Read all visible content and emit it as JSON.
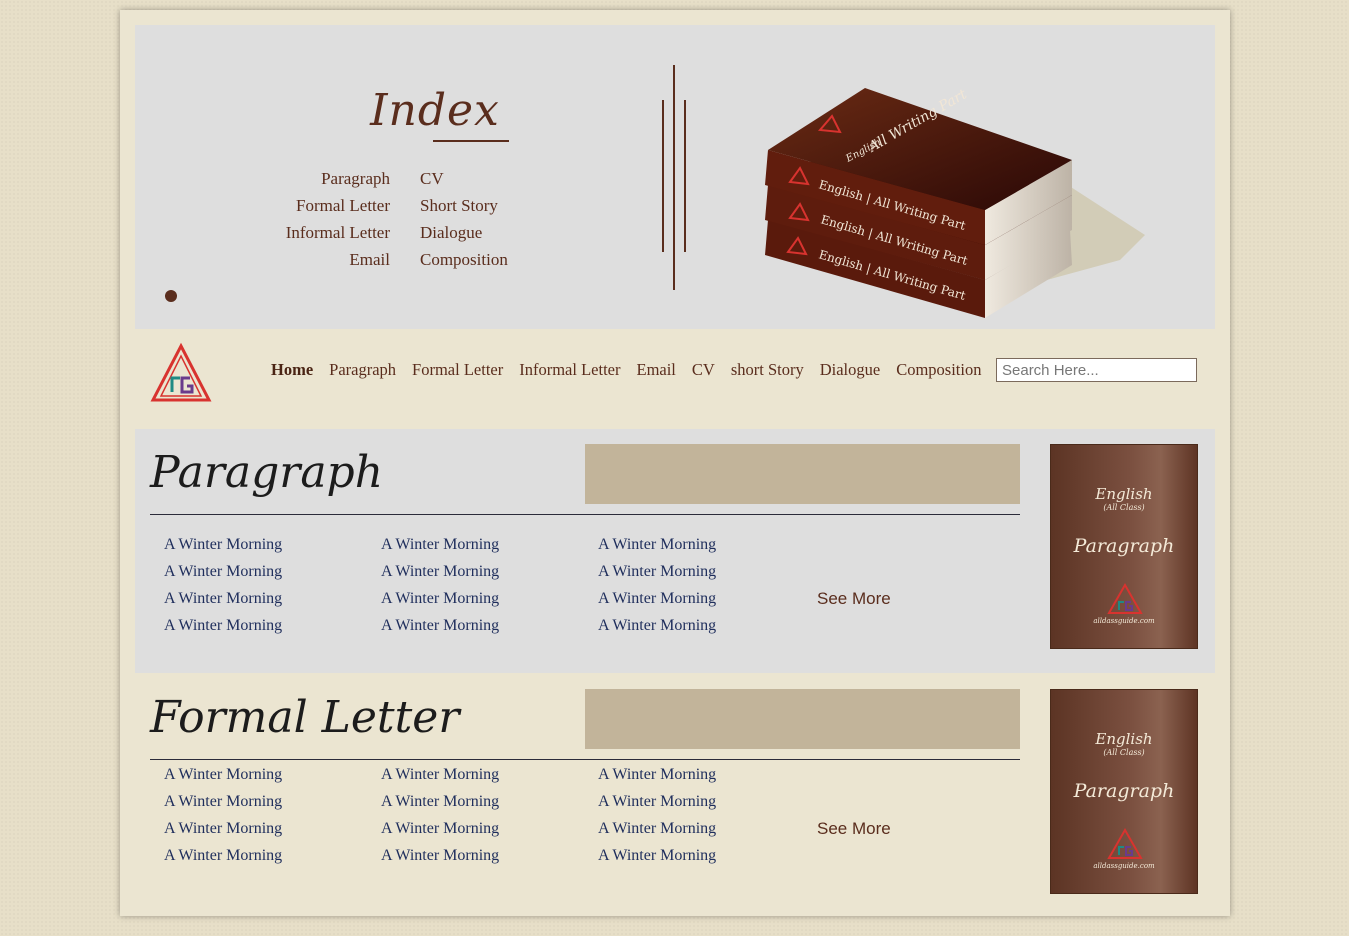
{
  "banner": {
    "index_title": "Index",
    "index_left": [
      "Paragraph",
      "Formal Letter",
      "Informal Letter",
      "Email"
    ],
    "index_right": [
      "CV",
      "Short Story",
      "Dialogue",
      "Composition"
    ],
    "book_spine_title": "English | All Writing Part",
    "book_top_brand": "English",
    "book_top_title": "All Writing Part"
  },
  "nav": {
    "items": [
      "Home",
      "Paragraph",
      "Formal Letter",
      "Informal Letter",
      "Email",
      "CV",
      "short Story",
      "Dialogue",
      "Composition"
    ],
    "search_placeholder": "Search Here..."
  },
  "sections": [
    {
      "title": "Paragraph",
      "links": [
        [
          "A Winter Morning",
          "A Winter Morning",
          "A Winter Morning"
        ],
        [
          "A Winter Morning",
          "A Winter Morning",
          "A Winter Morning"
        ],
        [
          "A Winter Morning",
          "A Winter Morning",
          "A Winter Morning"
        ],
        [
          "A Winter Morning",
          "A Winter Morning",
          "A Winter Morning"
        ]
      ],
      "see_more": "See More",
      "cover": {
        "line1": "English",
        "line2": "(All Class)",
        "line3": "Paragraph",
        "line4": "alldassguide.com"
      }
    },
    {
      "title": "Formal Letter",
      "links": [
        [
          "A Winter Morning",
          "A Winter Morning",
          "A Winter Morning"
        ],
        [
          "A Winter Morning",
          "A Winter Morning",
          "A Winter Morning"
        ],
        [
          "A Winter Morning",
          "A Winter Morning",
          "A Winter Morning"
        ],
        [
          "A Winter Morning",
          "A Winter Morning",
          "A Winter Morning"
        ]
      ],
      "see_more": "See More",
      "cover": {
        "line1": "English",
        "line2": "(All Class)",
        "line3": "Paragraph",
        "line4": "alldassguide.com"
      }
    }
  ],
  "colors": {
    "brown": "#5a2d1d",
    "link_blue": "#1f2e5c",
    "tan": "#c2b49a",
    "logo_red": "#d8332f",
    "logo_teal": "#1f8a84",
    "logo_purple": "#6a3b8c"
  }
}
